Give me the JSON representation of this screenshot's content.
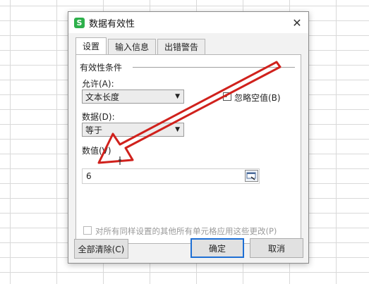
{
  "dialog": {
    "title": "数据有效性",
    "app_icon_letter": "S",
    "close_glyph": "✕"
  },
  "tabs": [
    {
      "label": "设置",
      "active": true
    },
    {
      "label": "输入信息",
      "active": false
    },
    {
      "label": "出错警告",
      "active": false
    }
  ],
  "settings": {
    "group_title": "有效性条件",
    "allow_label": "允许(A):",
    "allow_value": "文本长度",
    "ignore_blank_label": "忽略空值(B)",
    "ignore_blank_checked": true,
    "data_label": "数据(D):",
    "data_value": "等于",
    "value_label": "数值(V)",
    "value_input": "6",
    "apply_all_label": "对所有同样设置的其他所有单元格应用这些更改(P)",
    "apply_all_checked": false
  },
  "buttons": {
    "clear_all": "全部清除(C)",
    "ok": "确定",
    "cancel": "取消"
  },
  "icons": {
    "dropdown": "▼",
    "check": "✓"
  },
  "colors": {
    "app_icon": "#2db04b",
    "annotation_arrow": "#d0211c",
    "default_button_border": "#1e6fd4"
  }
}
